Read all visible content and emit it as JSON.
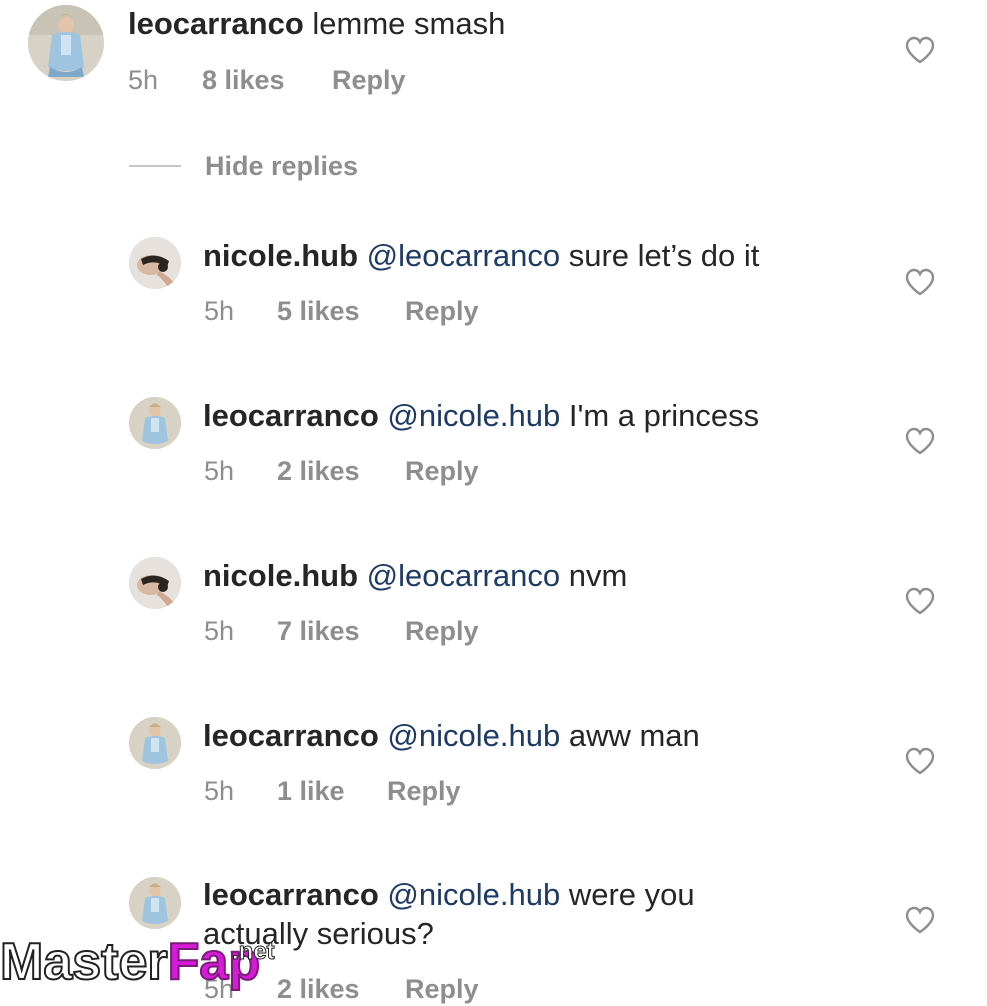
{
  "top_comment": {
    "username": "leocarranco",
    "text": "lemme smash",
    "time": "5h",
    "likes": "8 likes",
    "reply": "Reply"
  },
  "hide_replies_label": "Hide replies",
  "replies": [
    {
      "username": "nicole.hub",
      "mention": "@leocarranco",
      "text": "sure let’s do it",
      "time": "5h",
      "likes": "5 likes",
      "reply": "Reply",
      "avatar": "nicole"
    },
    {
      "username": "leocarranco",
      "mention": "@nicole.hub",
      "text": "I'm a princess",
      "time": "5h",
      "likes": "2 likes",
      "reply": "Reply",
      "avatar": "leo"
    },
    {
      "username": "nicole.hub",
      "mention": "@leocarranco",
      "text": "nvm",
      "time": "5h",
      "likes": "7 likes",
      "reply": "Reply",
      "avatar": "nicole"
    },
    {
      "username": "leocarranco",
      "mention": "@nicole.hub",
      "text": "aww man",
      "time": "5h",
      "likes": "1 like",
      "reply": "Reply",
      "avatar": "leo"
    },
    {
      "username": "leocarranco",
      "mention": "@nicole.hub",
      "text": "were you",
      "text_line2": "actually serious?",
      "time": "5h",
      "likes": "2 likes",
      "reply": "Reply",
      "avatar": "leo"
    }
  ],
  "watermark": {
    "master": "Master",
    "fap": "Fap",
    "net": ".net"
  },
  "icons": {
    "like": "heart-outline-icon"
  },
  "colors": {
    "username": "#262626",
    "mention": "#1e3a66",
    "meta": "#8e8e8e",
    "heart": "#8e8e8e"
  }
}
